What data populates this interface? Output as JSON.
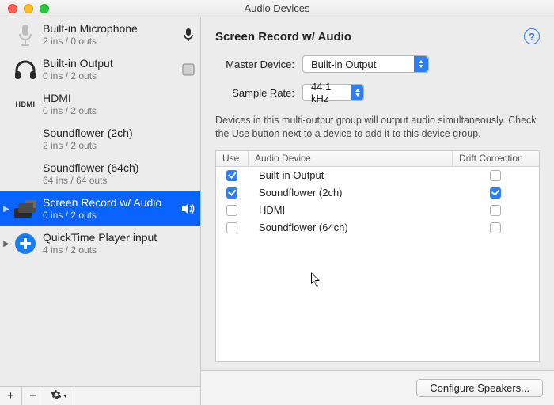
{
  "title": "Audio Devices",
  "sidebar": {
    "items": [
      {
        "name": "Built-in Microphone",
        "io": "2 ins / 0 outs",
        "icon": "mic-icon",
        "right_icon": "mic-glyph",
        "selected": false,
        "has_children": false
      },
      {
        "name": "Built-in Output",
        "io": "0 ins / 2 outs",
        "icon": "headphones-icon",
        "right_icon": "thru-glyph",
        "selected": false,
        "has_children": false
      },
      {
        "name": "HDMI",
        "io": "0 ins / 2 outs",
        "icon": "hdmi-icon",
        "right_icon": "",
        "selected": false,
        "has_children": false
      },
      {
        "name": "Soundflower (2ch)",
        "io": "2 ins / 2 outs",
        "icon": "blank-icon",
        "right_icon": "",
        "selected": false,
        "has_children": false
      },
      {
        "name": "Soundflower (64ch)",
        "io": "64 ins / 64 outs",
        "icon": "blank-icon",
        "right_icon": "",
        "selected": false,
        "has_children": false
      },
      {
        "name": "Screen Record w/ Audio",
        "io": "0 ins / 2 outs",
        "icon": "multioutput-icon",
        "right_icon": "speaker-glyph",
        "selected": true,
        "has_children": true
      },
      {
        "name": "QuickTime Player input",
        "io": "4 ins / 2 outs",
        "icon": "aggregate-icon",
        "right_icon": "",
        "selected": false,
        "has_children": true
      }
    ],
    "footer": {
      "add": "+",
      "remove": "−",
      "gear": ""
    }
  },
  "detail": {
    "heading": "Screen Record w/ Audio",
    "master_label": "Master Device:",
    "master_value": "Built-in Output",
    "sample_label": "Sample Rate:",
    "sample_value": "44.1 kHz",
    "hint": "Devices in this multi-output group will output audio simultaneously. Check the Use button next to a device to add it to this device group.",
    "columns": {
      "use": "Use",
      "device": "Audio Device",
      "drift": "Drift Correction"
    },
    "rows": [
      {
        "use": true,
        "name": "Built-in Output",
        "drift": false
      },
      {
        "use": true,
        "name": "Soundflower (2ch)",
        "drift": true
      },
      {
        "use": false,
        "name": "HDMI",
        "drift": false
      },
      {
        "use": false,
        "name": "Soundflower (64ch)",
        "drift": false
      }
    ],
    "configure": "Configure Speakers..."
  }
}
